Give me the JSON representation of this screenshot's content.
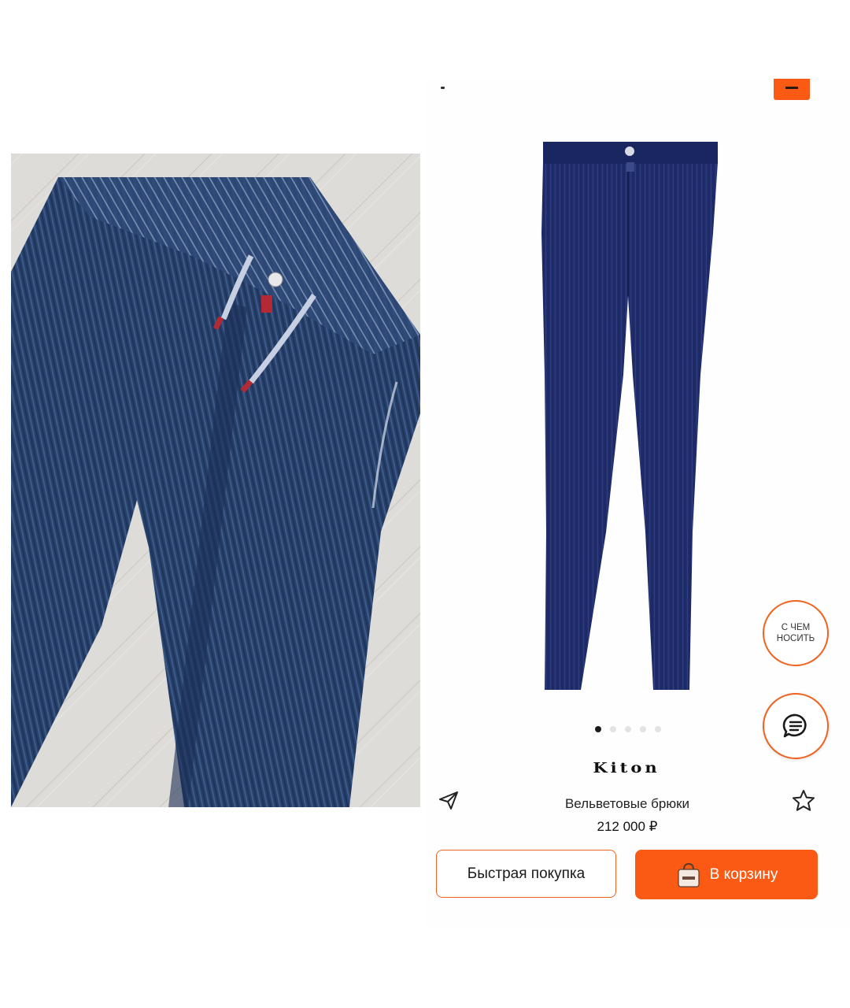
{
  "colors": {
    "accent": "#fb5a14",
    "text": "#222222"
  },
  "gallery": {
    "dot_count": 5,
    "active_index": 0
  },
  "brand": {
    "name": "Kiton"
  },
  "product": {
    "name": "Вельветовые брюки",
    "price": "212 000 ₽"
  },
  "actions": {
    "quick_buy": "Быстрая покупка",
    "add_to_cart": "В корзину"
  },
  "floating": {
    "what_to_wear_line1": "С ЧЕМ",
    "what_to_wear_line2": "НОСИТЬ"
  },
  "icons": [
    "share-icon",
    "star-icon",
    "shopping-bag-icon",
    "chat-icon",
    "menu-icon"
  ]
}
